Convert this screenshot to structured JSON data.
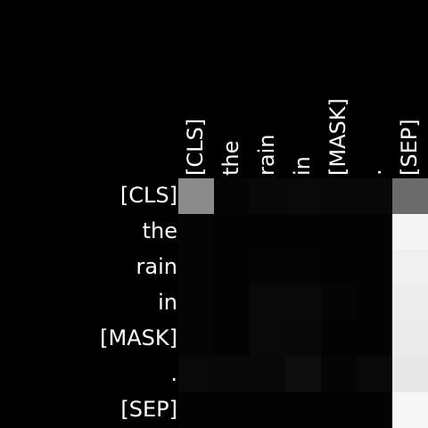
{
  "chart_data": {
    "type": "heatmap",
    "x_labels": [
      "[CLS]",
      "the",
      "rain",
      "in",
      "[MASK]",
      ".",
      "[SEP]"
    ],
    "y_labels": [
      "[CLS]",
      "the",
      "rain",
      "in",
      "[MASK]",
      ".",
      "[SEP]"
    ],
    "colormap": "greys (black = 0, white = 1)",
    "vlim": [
      0,
      1
    ],
    "values": [
      [
        0.55,
        0.02,
        0.03,
        0.04,
        0.03,
        0.03,
        0.42
      ],
      [
        0.02,
        0.01,
        0.01,
        0.01,
        0.01,
        0.01,
        0.96
      ],
      [
        0.02,
        0.01,
        0.02,
        0.02,
        0.01,
        0.01,
        0.94
      ],
      [
        0.02,
        0.01,
        0.04,
        0.04,
        0.02,
        0.01,
        0.93
      ],
      [
        0.02,
        0.01,
        0.04,
        0.03,
        0.01,
        0.01,
        0.92
      ],
      [
        0.04,
        0.03,
        0.03,
        0.06,
        0.02,
        0.04,
        0.91
      ],
      [
        0.01,
        0.01,
        0.01,
        0.01,
        0.01,
        0.01,
        0.97
      ]
    ]
  }
}
